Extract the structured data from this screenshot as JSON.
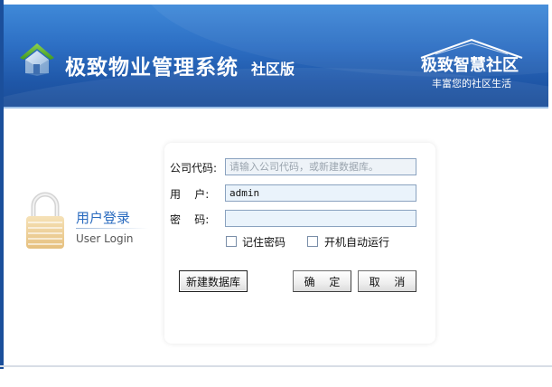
{
  "banner": {
    "title": "极致物业管理系统",
    "edition": "社区版",
    "brand_name": "极致智慧社区",
    "brand_slogan": "丰富您的社区生活"
  },
  "login_badge": {
    "title": "用户登录",
    "subtitle": "User Login"
  },
  "form": {
    "company_label": "公司代码:",
    "company_value": "",
    "company_placeholder": "请输入公司代码，或新建数据库。",
    "user_label": "用    户:",
    "user_value": "admin",
    "password_label": "密    码:",
    "password_value": "",
    "remember_label": "记住密码",
    "remember_checked": false,
    "autorun_label": "开机自动运行",
    "autorun_checked": false
  },
  "buttons": {
    "new_db_label": "新建数据库",
    "ok_label": "确 定",
    "cancel_label": "取 消"
  },
  "colors": {
    "banner_blue": "#2d6fc4",
    "login_title_blue": "#2a6bbf",
    "input_bg": "#eaf3fb"
  },
  "icons": {
    "app_logo": "house-icon",
    "login_badge": "lock-icon"
  }
}
